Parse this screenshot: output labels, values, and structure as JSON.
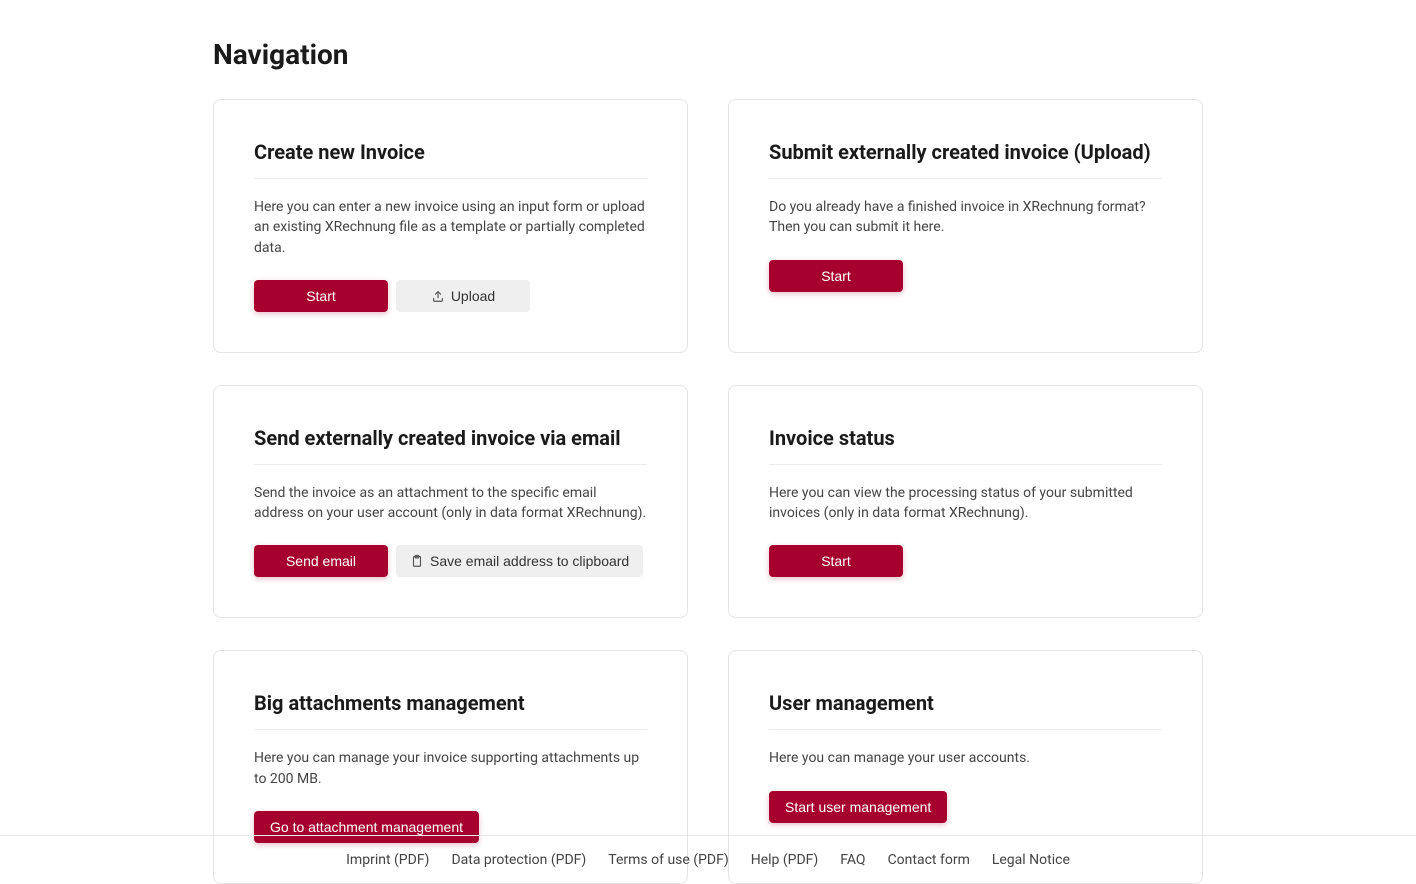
{
  "page": {
    "title": "Navigation"
  },
  "cards": {
    "create_invoice": {
      "title": "Create new Invoice",
      "desc": "Here you can enter a new invoice using an input form or upload an existing XRechnung file as a template or partially completed data.",
      "start_label": "Start",
      "upload_label": "Upload"
    },
    "submit_upload": {
      "title": "Submit externally created invoice (Upload)",
      "desc": "Do you already have a finished invoice in XRechnung format? Then you can submit it here.",
      "start_label": "Start"
    },
    "send_email": {
      "title": "Send externally created invoice via email",
      "desc": "Send the invoice as an attachment to the specific email address on your user account (only in data format XRechnung).",
      "send_label": "Send email",
      "copy_label": "Save email address to clipboard"
    },
    "invoice_status": {
      "title": "Invoice status",
      "desc": "Here you can view the processing status of your submitted invoices (only in data format XRechnung).",
      "start_label": "Start"
    },
    "attachments": {
      "title": "Big attachments management",
      "desc": "Here you can manage your invoice supporting attachments up to 200 MB.",
      "go_label": "Go to attachment management"
    },
    "user_mgmt": {
      "title": "User management",
      "desc": "Here you can manage your user accounts.",
      "start_label": "Start user management"
    }
  },
  "footer": {
    "imprint": "Imprint (PDF)",
    "data_protection": "Data protection (PDF)",
    "terms": "Terms of use (PDF)",
    "help": "Help (PDF)",
    "faq": "FAQ",
    "contact": "Contact form",
    "legal": "Legal Notice"
  }
}
